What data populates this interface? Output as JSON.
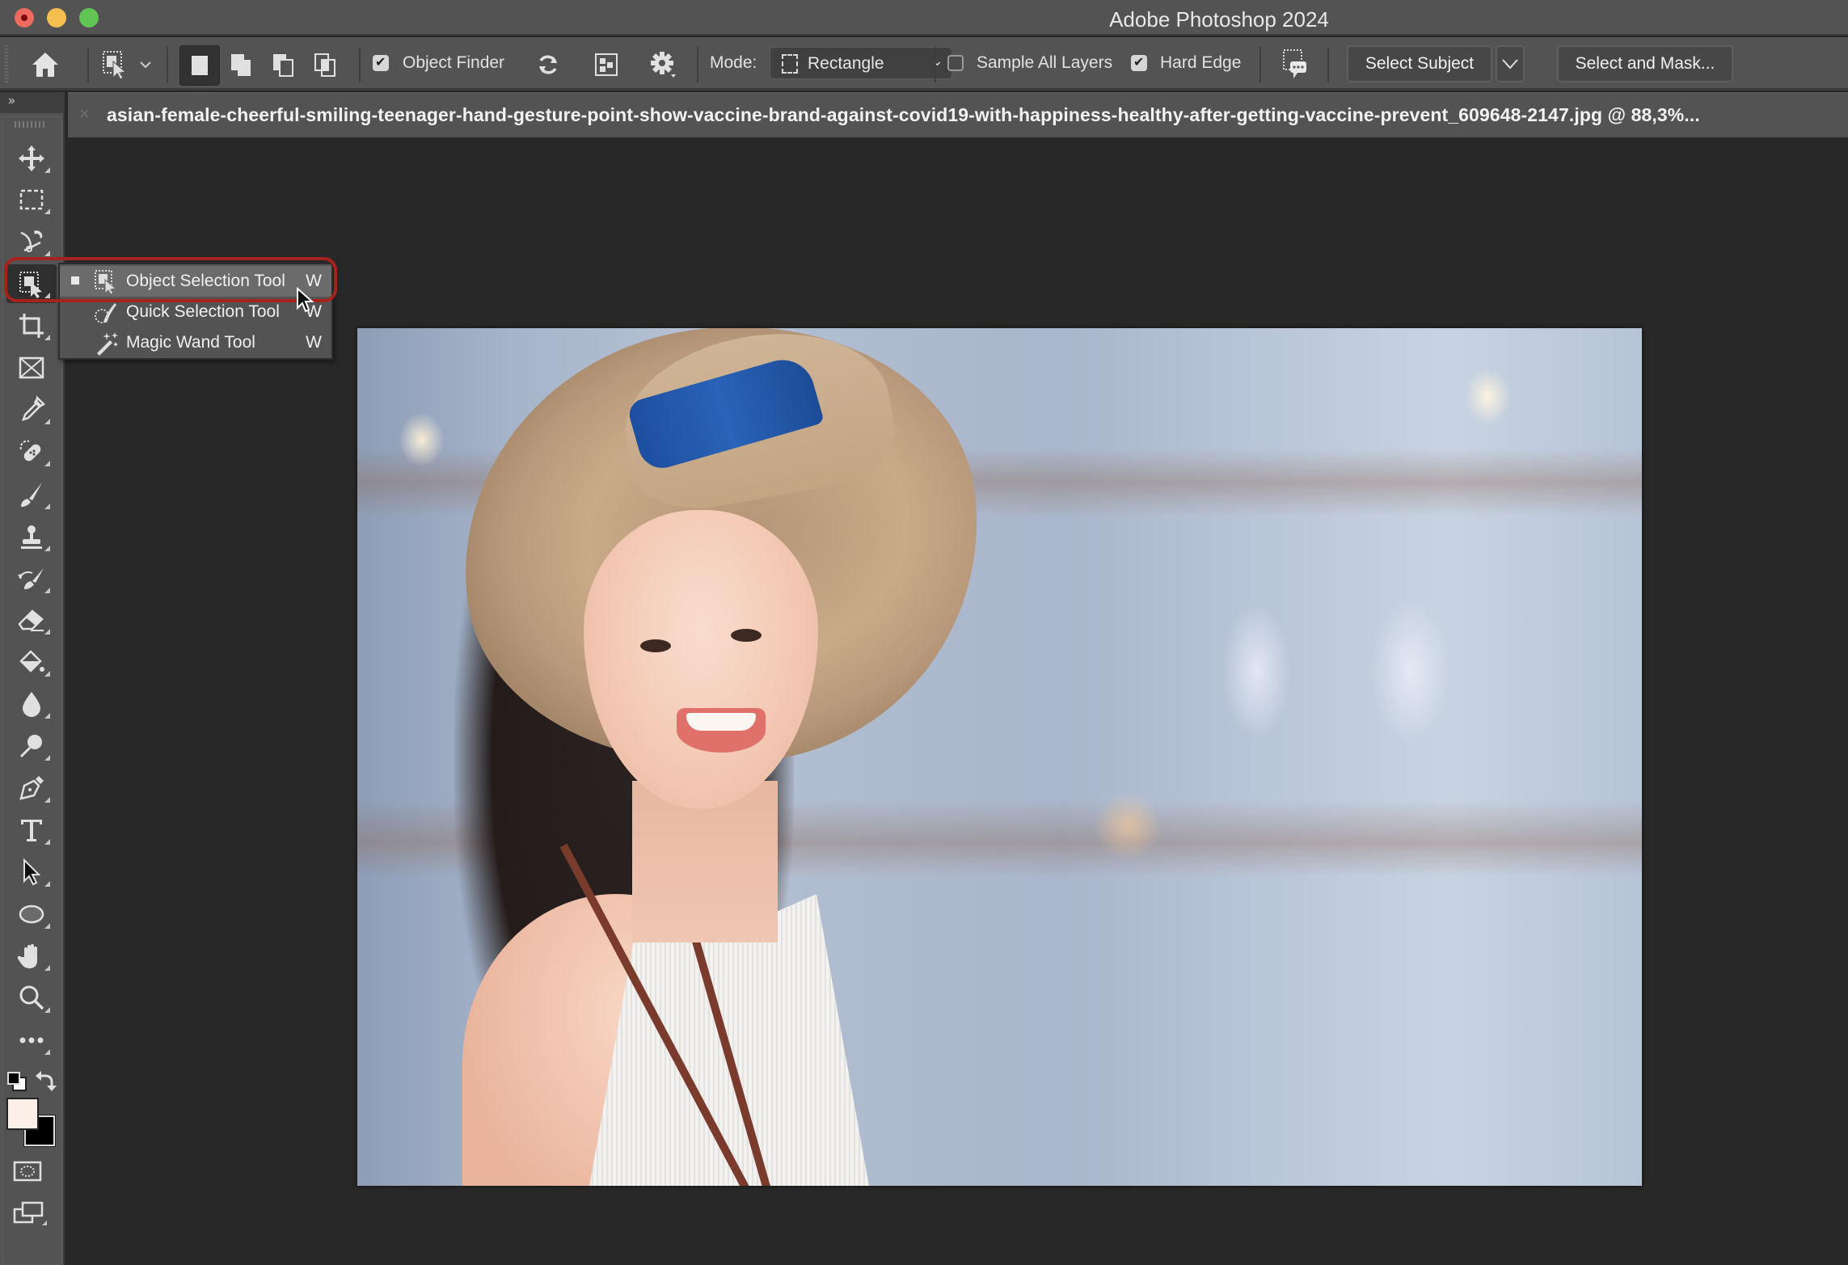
{
  "window": {
    "title": "Adobe Photoshop 2024",
    "traffic_lights": [
      "close",
      "minimize",
      "zoom"
    ],
    "colors": {
      "close": "#ed6a5e",
      "minimize": "#f5bf4f",
      "zoom": "#61c454"
    }
  },
  "options_bar": {
    "home_icon": "home-icon",
    "tool_preset_icon": "object-selection-tool-icon",
    "selection_modes": [
      "new-selection",
      "add-to-selection",
      "subtract-from-selection",
      "intersect-with-selection"
    ],
    "active_selection_mode": "new-selection",
    "object_finder": {
      "label": "Object Finder",
      "checked": true
    },
    "refresh_icon": "refresh-icon",
    "show_all_objects_icon": "show-all-objects-icon",
    "settings_icon": "gear-icon",
    "mode": {
      "label": "Mode:",
      "value": "Rectangle"
    },
    "sample_all_layers": {
      "label": "Sample All Layers",
      "checked": false
    },
    "hard_edge": {
      "label": "Hard Edge",
      "checked": true
    },
    "feedback_icon": "feedback-icon",
    "select_subject_label": "Select Subject",
    "select_and_mask_label": "Select and Mask..."
  },
  "document": {
    "close_label": "×",
    "tab_title": "asian-female-cheerful-smiling-teenager-hand-gesture-point-show-vaccine-brand-against-covid19-with-happiness-healthy-after-getting-vaccine-prevent_609648-2147.jpg @ 88,3%..."
  },
  "toolbar": {
    "collapse_label": "››",
    "tools": [
      {
        "name": "move-tool",
        "icon": "move-icon"
      },
      {
        "name": "rectangular-marquee-tool",
        "icon": "marquee-icon"
      },
      {
        "name": "lasso-tool",
        "icon": "magnetic-lasso-icon"
      },
      {
        "name": "object-selection-tool",
        "icon": "object-selection-icon",
        "active": true
      },
      {
        "name": "crop-tool",
        "icon": "crop-icon"
      },
      {
        "name": "frame-tool",
        "icon": "frame-icon"
      },
      {
        "name": "eyedropper-tool",
        "icon": "eyedropper-icon"
      },
      {
        "name": "spot-healing-tool",
        "icon": "bandage-icon"
      },
      {
        "name": "brush-tool",
        "icon": "brush-icon"
      },
      {
        "name": "clone-stamp-tool",
        "icon": "stamp-icon"
      },
      {
        "name": "history-brush-tool",
        "icon": "history-brush-icon"
      },
      {
        "name": "eraser-tool",
        "icon": "eraser-icon"
      },
      {
        "name": "paint-bucket-tool",
        "icon": "paint-bucket-icon"
      },
      {
        "name": "blur-tool",
        "icon": "drop-icon"
      },
      {
        "name": "dodge-tool",
        "icon": "dodge-icon"
      },
      {
        "name": "pen-tool",
        "icon": "pen-icon"
      },
      {
        "name": "type-tool",
        "icon": "type-icon"
      },
      {
        "name": "path-selection-tool",
        "icon": "arrow-icon"
      },
      {
        "name": "ellipse-tool",
        "icon": "ellipse-icon"
      },
      {
        "name": "hand-tool",
        "icon": "hand-icon"
      },
      {
        "name": "zoom-tool",
        "icon": "zoom-icon"
      },
      {
        "name": "edit-toolbar",
        "icon": "more-icon"
      }
    ],
    "foreground_color": "#fcefe8",
    "background_color": "#000000",
    "quick_mask_icon": "quick-mask-icon",
    "screen_mode_icon": "screen-mode-icon"
  },
  "tool_flyout": {
    "items": [
      {
        "label": "Object Selection Tool",
        "shortcut": "W",
        "icon": "object-selection-icon",
        "selected": true
      },
      {
        "label": "Quick Selection Tool",
        "shortcut": "W",
        "icon": "quick-selection-icon",
        "selected": false
      },
      {
        "label": "Magic Wand Tool",
        "shortcut": "W",
        "icon": "magic-wand-icon",
        "selected": false
      }
    ],
    "highlight_color": "#a5231c"
  },
  "canvas": {
    "background": "#282828",
    "image_description": "Smiling young woman in a straw hat with a blue band, white sleeveless top and brown shoulder strap, blurred cafe background"
  }
}
